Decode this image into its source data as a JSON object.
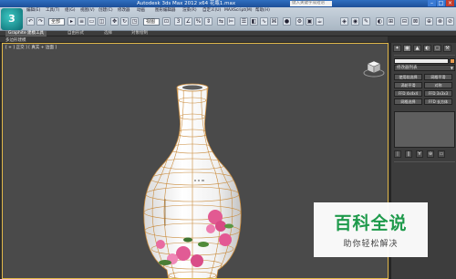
{
  "titlebar": {
    "title": "Autodesk 3ds Max  2012 x64    花瓶1.max",
    "search_placeholder": "键入关键字或短语"
  },
  "toolbar": {
    "logo": "3",
    "menu": [
      "编辑(E)",
      "工具(T)",
      "组(G)",
      "视图(V)",
      "创建(C)",
      "修改器",
      "动画",
      "图形编辑器",
      "渲染(R)",
      "自定义(U)",
      "MAXScript(M)",
      "帮助(H)"
    ],
    "select_filter": "全部",
    "view_select": "视图",
    "snap_value": "3"
  },
  "ribbon": {
    "tabs": [
      "Graphite 建模工具",
      "自由形式",
      "选择",
      "对象绘制"
    ],
    "active_tab": "Graphite 建模工具",
    "sub_label": "多边形建模"
  },
  "viewport": {
    "label": "[ + ] 正交 ] [ 真实 + 边面 ]"
  },
  "command_panel": {
    "tabs": [
      "✦",
      "◉",
      "▲",
      "◐",
      "□",
      "⚒"
    ],
    "modifier_list": "修改器列表",
    "buttons": [
      "使用软选择",
      "网格平滑",
      "涡轮平滑",
      "对称",
      "FFD 4x4x4",
      "FFD 3x3x3",
      "网格选择",
      "FFD 长方体"
    ],
    "stack_icons": [
      "|",
      "‖",
      "∀",
      "⊕",
      "▭"
    ]
  },
  "watermark": {
    "title": "百科全说",
    "subtitle": "助你轻松解决"
  },
  "colors": {
    "titlebar": "#2f6fc0",
    "viewport_bg": "#4a4a4a",
    "viewport_border": "#e1b84a",
    "wireframe": "#c98a3a",
    "watermark_green": "#1e9a4b"
  }
}
